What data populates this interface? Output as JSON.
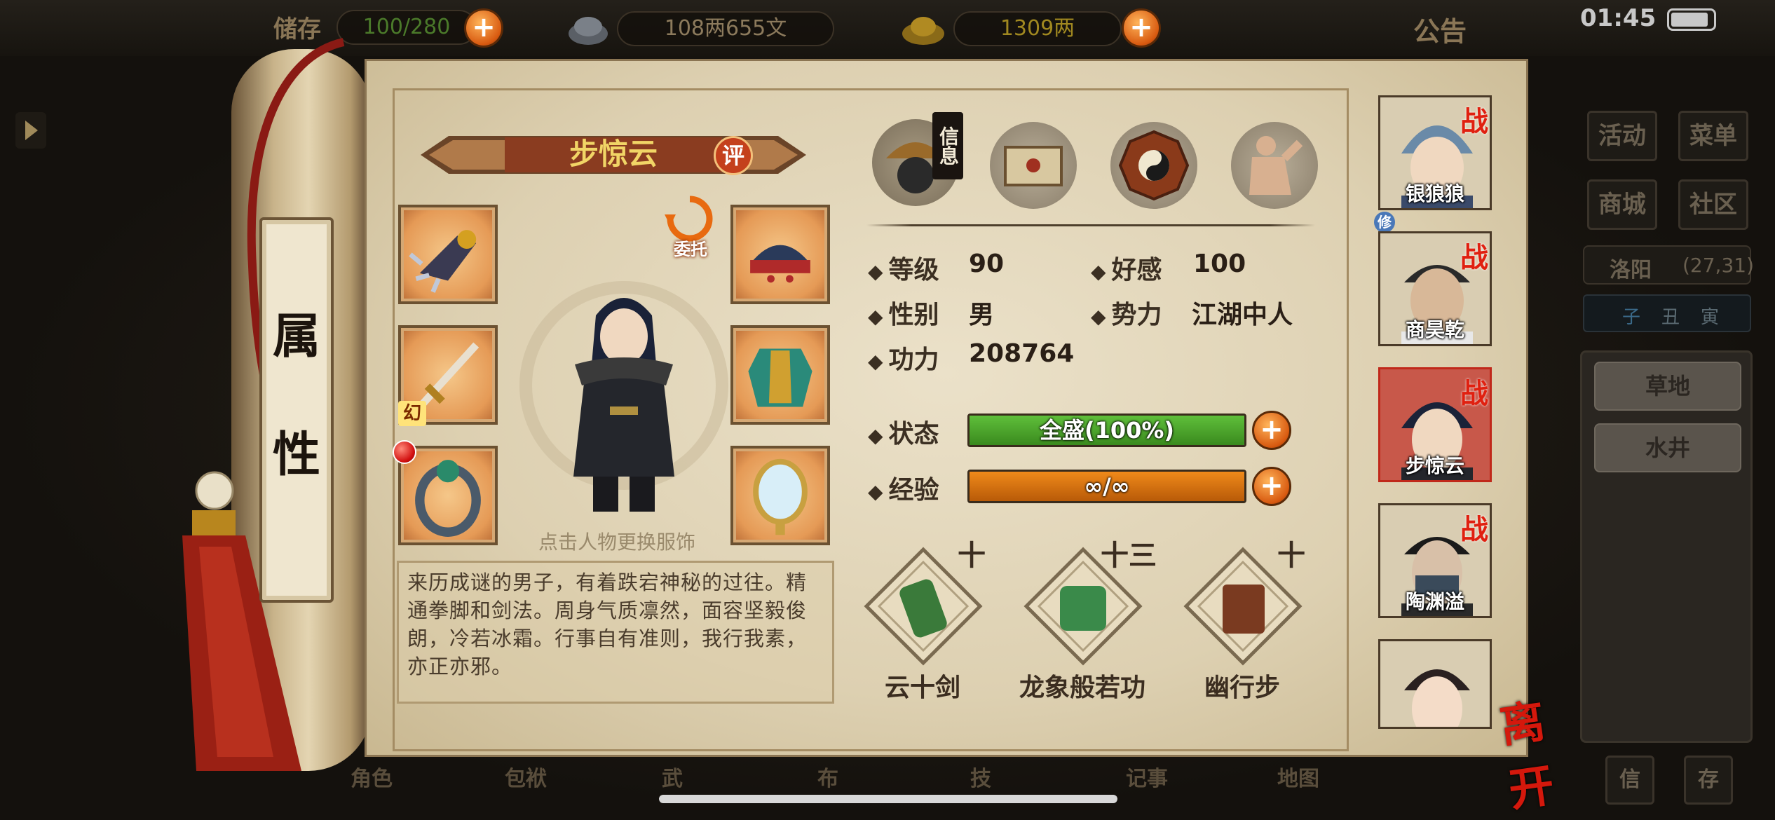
{
  "topbar": {
    "storage_label": "储存",
    "storage_value": "100/280",
    "money": "108两655文",
    "gold": "1309两",
    "notice": "公告",
    "time": "01:45",
    "battery_level": 0.9
  },
  "right_menu": {
    "buttons": [
      "活动",
      "菜单",
      "商城",
      "社区"
    ],
    "location": "洛阳",
    "coords": "(27,31)",
    "time_slots": [
      "子",
      "丑",
      "寅"
    ],
    "places": [
      "草地",
      "水井"
    ],
    "bottom_buttons": [
      "信",
      "存"
    ]
  },
  "scroll": {
    "vertical_title": [
      "属",
      "性"
    ]
  },
  "character": {
    "name": "步惊云",
    "rate_badge": "评",
    "entrust": "委托",
    "illusion_tag": "幻",
    "change_outfit_hint": "点击人物更换服饰",
    "description": "来历成谜的男子，有着跌宕神秘的过往。精通拳脚和剑法。周身气质凛然，面容坚毅俊朗，冷若冰霜。行事自有准则，我行我素，亦正亦邪。"
  },
  "info_tab": {
    "label": "信息"
  },
  "stats": {
    "level_label": "等级",
    "level": "90",
    "favor_label": "好感",
    "favor": "100",
    "gender_label": "性别",
    "gender": "男",
    "faction_label": "势力",
    "faction": "江湖中人",
    "power_label": "功力",
    "power": "208764",
    "state_label": "状态",
    "state_text": "全盛(100%)",
    "state_fill": 1.0,
    "exp_label": "经验",
    "exp_text": "∞/∞",
    "exp_fill": 1.0,
    "plus": "+"
  },
  "skills": [
    {
      "name": "云十剑",
      "level": "十"
    },
    {
      "name": "龙象般若功",
      "level": "十三"
    },
    {
      "name": "幽行步",
      "level": "十"
    }
  ],
  "roster": [
    {
      "name": "银狼狼",
      "tag": "战"
    },
    {
      "name": "商昊乾",
      "tag": "战"
    },
    {
      "name": "步惊云",
      "tag": "战"
    },
    {
      "name": "陶渊溢",
      "tag": "战"
    },
    {
      "name": "",
      "tag": ""
    }
  ],
  "roster_badge": "修",
  "leave": "离开",
  "bottom_nav": [
    "角色",
    "包袱",
    "武",
    "布",
    "技",
    "记事",
    "地图"
  ],
  "colors": {
    "state_bar": "#5fbf3a",
    "exp_bar": "#f08a1a",
    "accent_red": "#d4180c"
  }
}
